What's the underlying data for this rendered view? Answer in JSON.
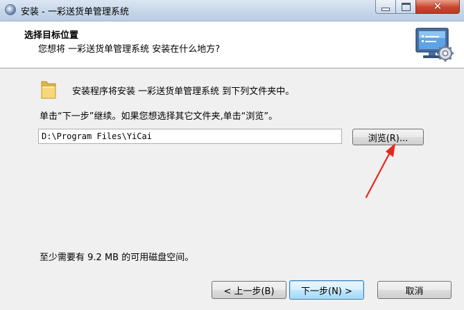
{
  "window": {
    "title": "安装 - 一彩送货单管理系统",
    "icon": "installer-disc-icon",
    "controls": {
      "minimize": "minimize-icon",
      "maximize": "maximize-icon",
      "close": "close-icon"
    }
  },
  "header": {
    "title": "选择目标位置",
    "subtitle": "您想将 一彩送货单管理系统 安装在什么地方?",
    "image": "wizard-computer-gear-icon"
  },
  "body": {
    "folder_icon": "folder-icon",
    "intro": "安装程序将安装 一彩送货单管理系统 到下列文件夹中。",
    "instruction": "单击“下一步”继续。如果您想选择其它文件夹,单击“浏览”。",
    "path_value": "D:\\Program Files\\YiCai",
    "browse_label": "浏览(R)...",
    "space_required": "至少需要有 9.2 MB 的可用磁盘空间。"
  },
  "footer": {
    "back_label": "< 上一步(B)",
    "next_label": "下一步(N) >",
    "cancel_label": "取消"
  },
  "colors": {
    "accent": "#3c7fb1",
    "annotation_arrow": "#e8261f"
  }
}
